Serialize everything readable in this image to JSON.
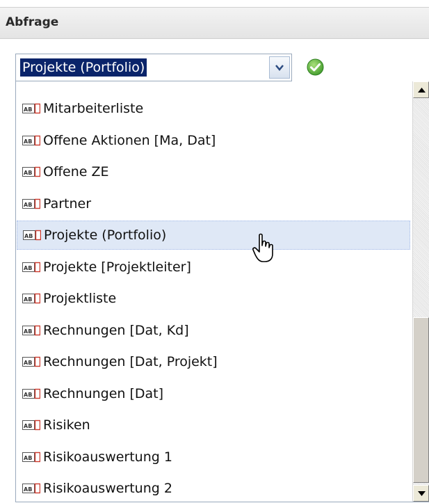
{
  "panel": {
    "title": "Abfrage"
  },
  "combo": {
    "selected_value": "Projekte (Portfolio)",
    "trigger_icon": "chevron-down-icon",
    "ok_icon": "check-circle-icon",
    "selection_color": "#0a246a"
  },
  "list": {
    "item_icon": "text-field-icon",
    "hover_color": "#dfe8f6",
    "items": [
      {
        "label": "Mitarbeiterliste"
      },
      {
        "label": "Offene Aktionen [Ma, Dat]"
      },
      {
        "label": "Offene ZE"
      },
      {
        "label": "Partner"
      },
      {
        "label": "Projekte (Portfolio)",
        "hovered": true
      },
      {
        "label": "Projekte [Projektleiter]"
      },
      {
        "label": "Projektliste"
      },
      {
        "label": "Rechnungen [Dat, Kd]"
      },
      {
        "label": "Rechnungen [Dat, Projekt]"
      },
      {
        "label": "Rechnungen [Dat]"
      },
      {
        "label": "Risiken"
      },
      {
        "label": "Risikoauswertung 1"
      },
      {
        "label": "Risikoauswertung 2"
      }
    ]
  },
  "cursor": {
    "icon": "hand-pointer-icon"
  }
}
